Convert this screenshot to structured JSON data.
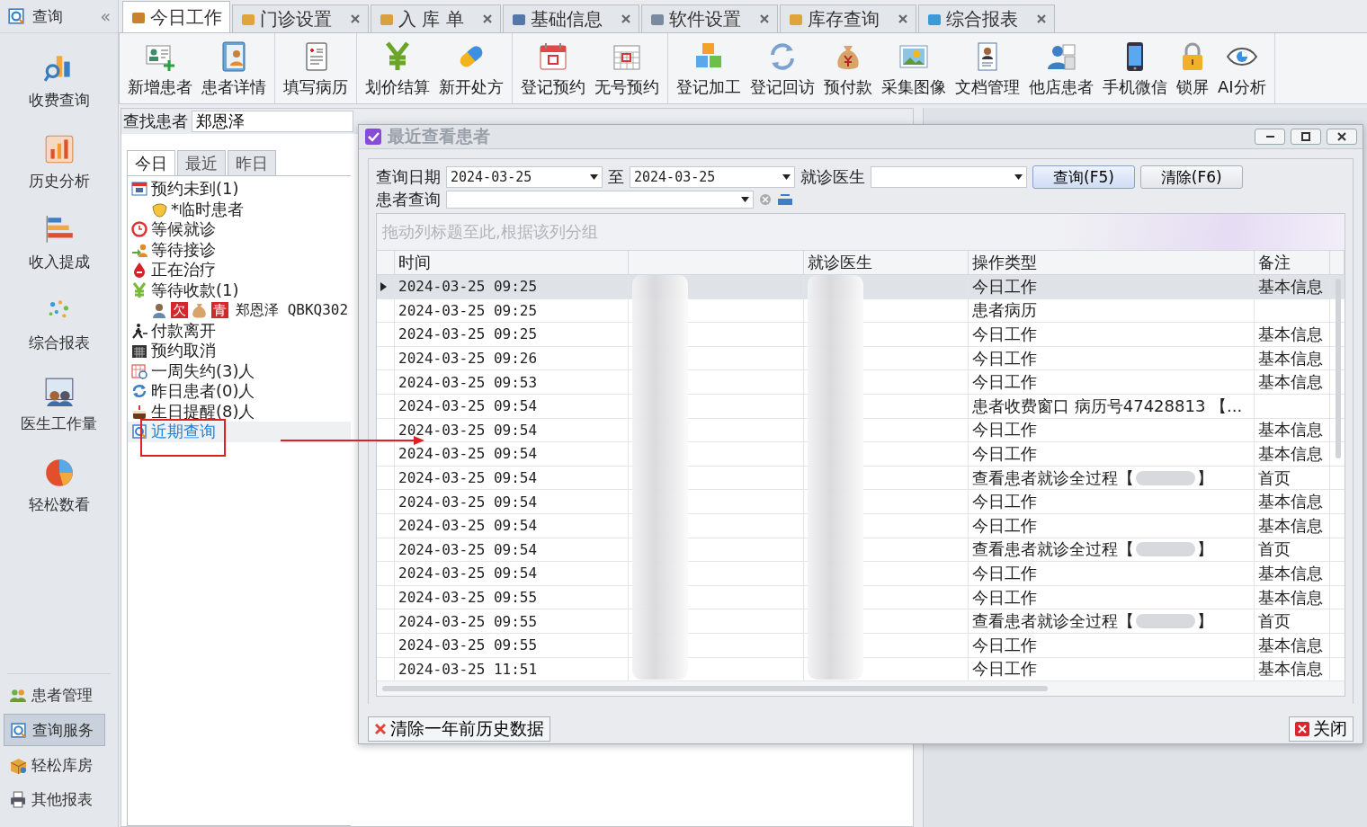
{
  "sidebar": {
    "title": "查询",
    "collapse": "«",
    "items": [
      {
        "label": "收费查询"
      },
      {
        "label": "历史分析"
      },
      {
        "label": "收入提成"
      },
      {
        "label": "综合报表"
      },
      {
        "label": "医生工作量"
      },
      {
        "label": "轻松数看"
      }
    ],
    "modules": [
      {
        "label": "患者管理",
        "selected": false
      },
      {
        "label": "查询服务",
        "selected": true
      },
      {
        "label": "轻松库房",
        "selected": false
      },
      {
        "label": "其他报表",
        "selected": false
      }
    ]
  },
  "tabs": [
    {
      "label": "今日工作",
      "selected": true,
      "closable": false
    },
    {
      "label": "门诊设置",
      "selected": false,
      "closable": true
    },
    {
      "label": "入 库 单",
      "selected": false,
      "closable": true
    },
    {
      "label": "基础信息",
      "selected": false,
      "closable": true
    },
    {
      "label": "软件设置",
      "selected": false,
      "closable": true
    },
    {
      "label": "库存查询",
      "selected": false,
      "closable": true
    },
    {
      "label": "综合报表",
      "selected": false,
      "closable": true
    }
  ],
  "toolbar": {
    "groups": [
      [
        "新增患者",
        "患者详情"
      ],
      [
        "填写病历"
      ],
      [
        "划价结算",
        "新开处方"
      ],
      [
        "登记预约",
        "无号预约"
      ],
      [
        "登记加工",
        "登记回访",
        "预付款",
        "采集图像",
        "文档管理",
        "他店患者",
        "手机微信",
        "锁屏",
        "AI分析"
      ]
    ]
  },
  "patient_search": {
    "label": "查找患者",
    "value": "郑恩泽"
  },
  "patient_tabs": [
    {
      "label": "今日",
      "selected": true
    },
    {
      "label": "最近",
      "selected": false
    },
    {
      "label": "昨日",
      "selected": false
    }
  ],
  "tree": [
    {
      "label": "预约未到(1)",
      "selected": false,
      "children": [
        {
          "label": "*临时患者",
          "selected": false
        }
      ]
    },
    {
      "label": "等候就诊",
      "selected": false
    },
    {
      "label": "等待接诊",
      "selected": false
    },
    {
      "label": "正在治疗",
      "selected": false
    },
    {
      "label": "等待收款(1)",
      "selected": false,
      "children": [
        {
          "kind": "patient",
          "badges": [
            "欠",
            "青"
          ],
          "label": "郑恩泽 QBKQ302",
          "selected": false
        }
      ]
    },
    {
      "label": "付款离开",
      "selected": false
    },
    {
      "label": "预约取消",
      "selected": false
    },
    {
      "label": "一周失约(3)人",
      "selected": false
    },
    {
      "label": "昨日患者(0)人",
      "selected": false
    },
    {
      "label": "生日提醒(8)人",
      "selected": false
    },
    {
      "label": "近期查询",
      "selected": true
    }
  ],
  "dialog": {
    "title": "最近查看患者",
    "form": {
      "date_label": "查询日期",
      "date_from": "2024-03-25",
      "to_label": "至",
      "date_to": "2024-03-25",
      "doctor_label": "就诊医生",
      "query_button": "查询(F5)",
      "clear_button": "清除(F6)",
      "patient_label": "患者查询"
    },
    "grid": {
      "group_hint": "拖动列标题至此,根据该列分组",
      "columns": [
        {
          "kind": "text",
          "label": "时间"
        },
        {
          "kind": "redacted"
        },
        {
          "kind": "text",
          "label": "就诊医生"
        },
        {
          "kind": "text",
          "label": "操作类型"
        },
        {
          "kind": "text",
          "label": "备注"
        }
      ],
      "rows": [
        {
          "time": "2024-03-25 09:25",
          "op": "今日工作",
          "note": "基本信息",
          "selected": true
        },
        {
          "time": "2024-03-25 09:25",
          "op": "患者病历",
          "selected": false
        },
        {
          "time": "2024-03-25 09:25",
          "op": "今日工作",
          "note": "基本信息",
          "selected": false
        },
        {
          "time": "2024-03-25 09:26",
          "op": "今日工作",
          "note": "基本信息",
          "selected": false
        },
        {
          "time": "2024-03-25 09:53",
          "op": "今日工作",
          "note": "基本信息",
          "selected": false
        },
        {
          "time": "2024-03-25 09:54",
          "op": "患者收费窗口  病历号47428813 【...",
          "selected": false
        },
        {
          "time": "2024-03-25 09:54",
          "op": "今日工作",
          "note": "基本信息",
          "selected": false
        },
        {
          "time": "2024-03-25 09:54",
          "op": "今日工作",
          "note": "基本信息",
          "selected": false
        },
        {
          "time": "2024-03-25 09:54",
          "op": "查看患者就诊全过程【",
          "op_after": "】",
          "redacted": true,
          "note": "首页",
          "selected": false
        },
        {
          "time": "2024-03-25 09:54",
          "op": "今日工作",
          "note": "基本信息",
          "selected": false
        },
        {
          "time": "2024-03-25 09:54",
          "op": "今日工作",
          "note": "基本信息",
          "selected": false
        },
        {
          "time": "2024-03-25 09:54",
          "op": "查看患者就诊全过程【",
          "op_after": "】",
          "redacted": true,
          "note": "首页",
          "selected": false
        },
        {
          "time": "2024-03-25 09:54",
          "op": "今日工作",
          "note": "基本信息",
          "selected": false
        },
        {
          "time": "2024-03-25 09:55",
          "op": "今日工作",
          "note": "基本信息",
          "selected": false
        },
        {
          "time": "2024-03-25 09:55",
          "op": "查看患者就诊全过程【",
          "op_after": "】",
          "redacted": true,
          "note": "首页",
          "selected": false
        },
        {
          "time": "2024-03-25 09:55",
          "op": "今日工作",
          "note": "基本信息",
          "selected": false
        },
        {
          "time": "2024-03-25 11:51",
          "op": "今日工作",
          "note": "基本信息",
          "selected": false
        }
      ]
    },
    "footer": {
      "purge_button": "清除一年前历史数据",
      "close_button": "关闭"
    }
  }
}
